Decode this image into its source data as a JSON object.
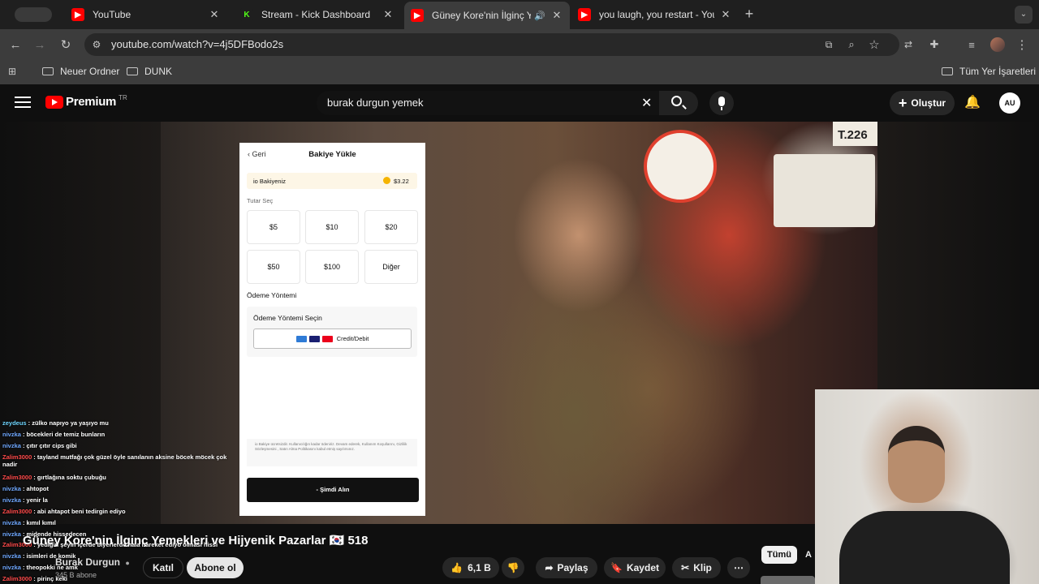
{
  "tabs": [
    {
      "title": "YouTube",
      "icon": "youtube-icon"
    },
    {
      "title": "Stream - Kick Dashboard",
      "icon": "kick-icon"
    },
    {
      "title": "Güney Kore'nin İlginç Yem",
      "icon": "youtube-icon",
      "active": true
    },
    {
      "title": "you laugh, you restart - YouTu",
      "icon": "youtube-icon"
    }
  ],
  "address_bar": {
    "url": "youtube.com/watch?v=4j5DFBodo2s"
  },
  "bookmarks": [
    {
      "label": "Neuer Ordner"
    },
    {
      "label": "DUNK"
    }
  ],
  "bookmarks_right": "Tüm Yer İşaretleri",
  "youtube": {
    "logo_text": "Premium",
    "logo_region": "TR",
    "search_value": "burak durgun yemek",
    "create_label": "Oluştur",
    "avatar_initials": "AU"
  },
  "modal": {
    "back_label": "Geri",
    "title": "Bakiye Yükle",
    "balance_label": "io Bakiyeniz",
    "balance_value": "$3.22",
    "amount_section": "Tutar Seç",
    "amounts": [
      "$5",
      "$10",
      "$20",
      "$50",
      "$100",
      "Diğer"
    ],
    "payment_section": "Ödeme Yöntemi",
    "payment_select_label": "Ödeme Yöntemi Seçin",
    "card_button_label": "Credit/Debit",
    "legal_text": "io Bakiye ücretsizdir. Kullanıcılığın kadar ödeniriz. Devam ederek, Kullanım Koşullarını, Gizlilik Sözleşmesini , Satın Alma Politikasını kabul etmiş sayılırsınız.",
    "submit_label": "- Şimdi Alın"
  },
  "chat": [
    {
      "user": "zeydeus",
      "text": ": zülko napıyo ya yaşıyo mu",
      "color": "#6fd6ff"
    },
    {
      "user": "nivzka",
      "text": ": böcekleri de temiz bunların",
      "color": "#6fa8ff"
    },
    {
      "user": "nivzka",
      "text": ": çıtır çıtır cips gibi",
      "color": "#6fa8ff"
    },
    {
      "user": "Zalim3000",
      "text": ": tayland mutfağı çok güzel öyle sanılanın aksine böcek möcek çok nadir",
      "color": "#ff4a4a"
    },
    {
      "user": "Zalim3000",
      "text": ": gırtlağına soktu çubuğu",
      "color": "#ff4a4a"
    },
    {
      "user": "nivzka",
      "text": ": ahtopot",
      "color": "#6fa8ff"
    },
    {
      "user": "nivzka",
      "text": ": yenir la",
      "color": "#6fa8ff"
    },
    {
      "user": "Zalim3000",
      "text": ": abi ahtapot beni tedirgin ediyo",
      "color": "#ff4a4a"
    },
    {
      "user": "nivzka",
      "text": ": kımıl kımıl",
      "color": "#6fa8ff"
    },
    {
      "user": "nivzka",
      "text": ": midende hissedecen",
      "color": "#6fa8ff"
    },
    {
      "user": "Zalim3000",
      "text": ": yediğin şeyin içerde biyerlerde hala hareket ediyo olması hissi",
      "color": "#ff4a4a"
    },
    {
      "user": "nivzka",
      "text": ": isimleri de komik",
      "color": "#6fa8ff"
    },
    {
      "user": "nivzka",
      "text": ": theopokki ne amk",
      "color": "#6fa8ff"
    },
    {
      "user": "Zalim3000",
      "text": ": pirinç keki",
      "color": "#ff4a4a"
    }
  ],
  "video": {
    "title": "Güney Kore'nin İlginç Yemekleri ve Hijyenik Pazarlar 🇰🇷 518",
    "sign_text": "T.226",
    "channel": "Burak Durgun",
    "subscribers": "345 B abone",
    "join_label": "Katıl",
    "subscribe_label": "Abone ol",
    "likes": "6,1 B",
    "share_label": "Paylaş",
    "save_label": "Kaydet",
    "clip_label": "Klip",
    "filter_all": "Tümü",
    "filter_next": "A"
  },
  "colors": {
    "youtube_red": "#ff0000",
    "kick_green": "#53fc18",
    "modal_button": "#111111"
  }
}
